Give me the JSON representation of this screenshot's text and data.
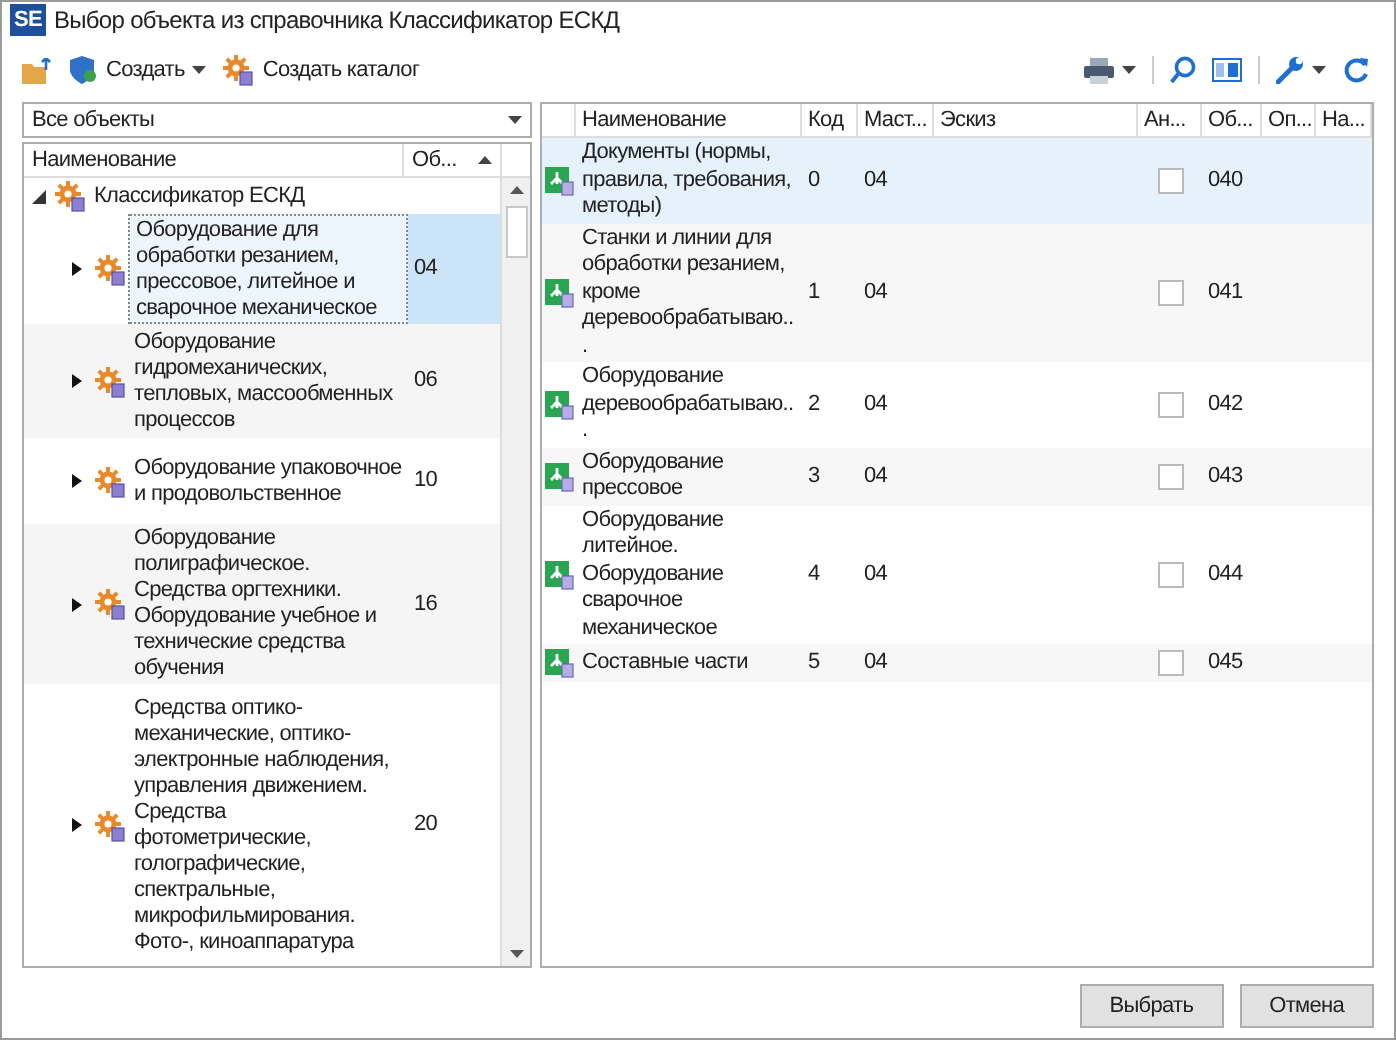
{
  "window": {
    "logo": "SE",
    "title": "Выбор объекта из справочника Классификатор ЕСКД"
  },
  "toolbar": {
    "create": "Создать",
    "create_catalog": "Создать каталог"
  },
  "filter": {
    "value": "Все объекты"
  },
  "tree": {
    "columns": [
      "Наименование",
      "Об..."
    ],
    "root": {
      "label": "Классификатор ЕСКД",
      "expanded": true,
      "children": [
        {
          "label": "Оборудование для обработки  резанием, прессовое, литейное и сварочное механическое",
          "code": "04",
          "expanded": false,
          "selected": true
        },
        {
          "label": "Оборудование гидромеханических, тепловых, массообменных процессов",
          "code": "06",
          "expanded": false,
          "selected": false
        },
        {
          "label": "Оборудование упаковочное и продовольственное",
          "code": "10",
          "expanded": false,
          "selected": false
        },
        {
          "label": "Оборудование полиграфическое. Средства оргтехники. Оборудование учебное и технические средства обучения",
          "code": "16",
          "expanded": false,
          "selected": false
        },
        {
          "label": "Средства оптико-механические, оптико-электронные наблюдения, управления движением. Средства фотометрические, голографические, спектральные, микрофильмирования. Фото-, киноаппаратура",
          "code": "20",
          "expanded": false,
          "selected": false
        }
      ]
    }
  },
  "table": {
    "columns": [
      "Наименование",
      "Код",
      "Маст...",
      "Эскиз",
      "Ан...",
      "Об...",
      "Оп...",
      "На..."
    ],
    "rows": [
      {
        "name": "Документы (нормы, правила, требования, методы)",
        "code": "0",
        "mast": "04",
        "checked": false,
        "ob": "040",
        "selected": true
      },
      {
        "name": "Станки и линии для обработки резанием, кроме деревообрабатываю...",
        "code": "1",
        "mast": "04",
        "checked": false,
        "ob": "041",
        "selected": false
      },
      {
        "name": "Оборудование деревообрабатываю...",
        "code": "2",
        "mast": "04",
        "checked": false,
        "ob": "042",
        "selected": false
      },
      {
        "name": "Оборудование прессовое",
        "code": "3",
        "mast": "04",
        "checked": false,
        "ob": "043",
        "selected": false
      },
      {
        "name": "Оборудование литейное. Оборудование сварочное механическое",
        "code": "4",
        "mast": "04",
        "checked": false,
        "ob": "044",
        "selected": false
      },
      {
        "name": "Составные части",
        "code": "5",
        "mast": "04",
        "checked": false,
        "ob": "045",
        "selected": false
      }
    ]
  },
  "buttons": [
    "Выбрать",
    "Отмена"
  ]
}
